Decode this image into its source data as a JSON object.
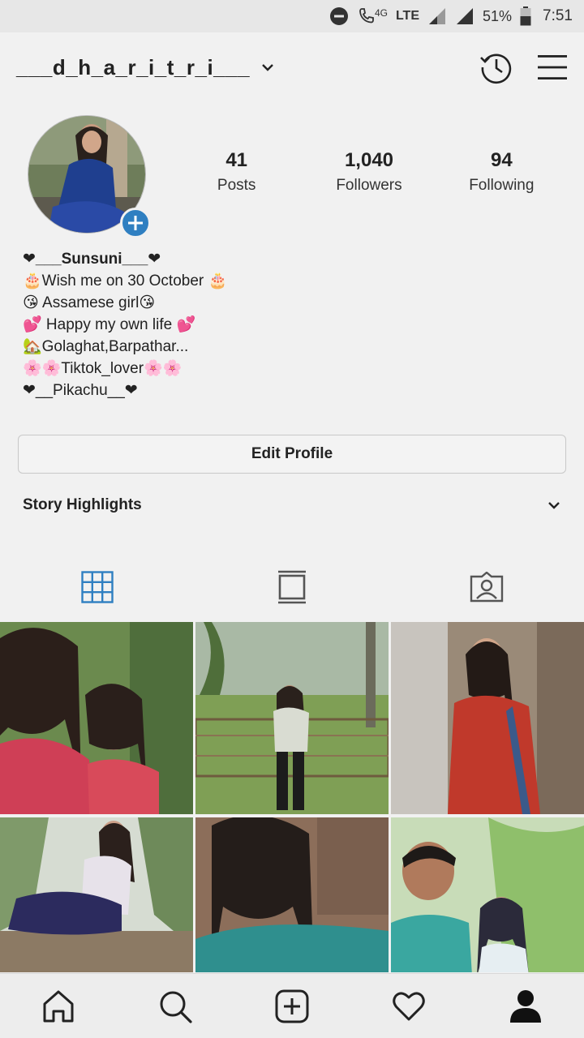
{
  "status_bar": {
    "network_4g": "4G",
    "network_lte": "LTE",
    "battery": "51%",
    "time": "7:51"
  },
  "header": {
    "username": "___d_h_a_r_i_t_r_i___",
    "icons": [
      "chevron-down-icon",
      "history-icon",
      "menu-icon"
    ]
  },
  "profile": {
    "stats": [
      {
        "value": "41",
        "label": "Posts"
      },
      {
        "value": "1,040",
        "label": "Followers"
      },
      {
        "value": "94",
        "label": "Following"
      }
    ],
    "bio": {
      "name": "❤___Sunsuni___❤",
      "lines": [
        "🎂Wish me on 30 October 🎂",
        " 😘 Assamese girl😘",
        " 💕 Happy my own life 💕",
        "🏡Golaghat,Barpathar...",
        " 🌸🌸Tiktok_lover🌸🌸",
        "❤__Pikachu__❤"
      ]
    },
    "edit_profile_label": "Edit Profile"
  },
  "highlights": {
    "title": "Story Highlights"
  },
  "tabs": [
    {
      "icon": "grid-icon",
      "active": true
    },
    {
      "icon": "igtv-icon",
      "active": false
    },
    {
      "icon": "tagged-icon",
      "active": false
    }
  ],
  "grid_posts": [
    {
      "kind": "photo",
      "palette": [
        "#6b8a4e",
        "#c94a5c",
        "#3a2d26"
      ]
    },
    {
      "kind": "photo",
      "palette": [
        "#7f9f55",
        "#a7b9a0",
        "#3b3b33"
      ]
    },
    {
      "kind": "photo",
      "palette": [
        "#9a8a78",
        "#c0392b",
        "#5a4a42"
      ]
    },
    {
      "kind": "photo",
      "palette": [
        "#c9d3c5",
        "#2c2b5e",
        "#8c7a64"
      ]
    },
    {
      "kind": "photo",
      "palette": [
        "#8c6e5a",
        "#2f8f8e",
        "#241d1a"
      ]
    },
    {
      "kind": "photo",
      "palette": [
        "#8fbf6b",
        "#3aa7a0",
        "#2b2a3a"
      ]
    }
  ],
  "bottom_nav": [
    {
      "icon": "home-icon"
    },
    {
      "icon": "search-icon"
    },
    {
      "icon": "new-post-icon"
    },
    {
      "icon": "activity-heart-icon"
    },
    {
      "icon": "profile-icon"
    }
  ],
  "colors": {
    "accent": "#2f7fc1",
    "background": "#f1f1f1",
    "text": "#222222"
  }
}
